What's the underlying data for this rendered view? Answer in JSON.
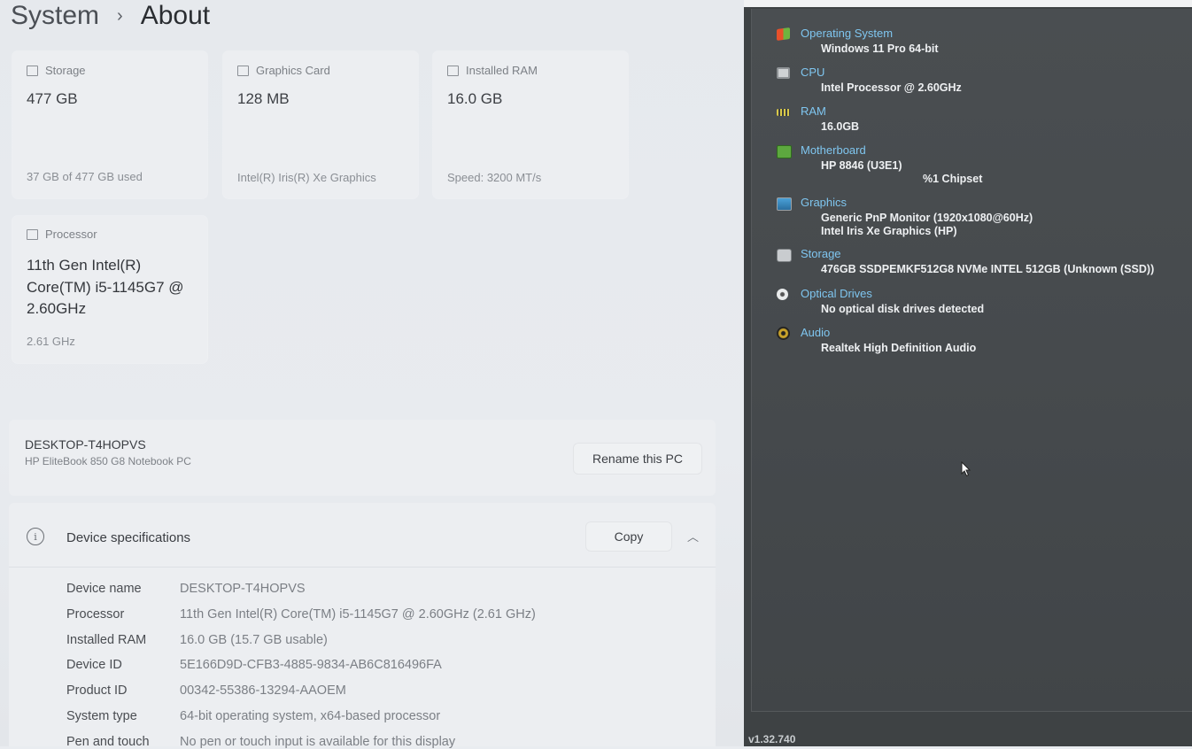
{
  "breadcrumb": {
    "parent": "System",
    "separator": "›",
    "current": "About"
  },
  "cards": {
    "storage": {
      "label": "Storage",
      "value": "477 GB",
      "sub": "37 GB of 477 GB used"
    },
    "graphics": {
      "label": "Graphics Card",
      "value": "128 MB",
      "sub": "Intel(R) Iris(R) Xe Graphics"
    },
    "ram": {
      "label": "Installed RAM",
      "value": "16.0 GB",
      "sub": "Speed: 3200 MT/s"
    },
    "processor": {
      "label": "Processor",
      "value": "11th Gen Intel(R) Core(TM) i5-1145G7 @ 2.60GHz",
      "sub": "2.61 GHz"
    }
  },
  "pc": {
    "name": "DESKTOP-T4HOPVS",
    "model": "HP EliteBook 850 G8 Notebook PC",
    "rename_label": "Rename this PC"
  },
  "specs": {
    "title": "Device specifications",
    "copy_label": "Copy",
    "rows": [
      {
        "key": "Device name",
        "value": "DESKTOP-T4HOPVS"
      },
      {
        "key": "Processor",
        "value": "11th Gen Intel(R) Core(TM) i5-1145G7 @ 2.60GHz (2.61 GHz)"
      },
      {
        "key": "Installed RAM",
        "value": "16.0 GB (15.7 GB usable)"
      },
      {
        "key": "Device ID",
        "value": "5E166D9D-CFB3-4885-9834-AB6C816496FA"
      },
      {
        "key": "Product ID",
        "value": "00342-55386-13294-AAOEM"
      },
      {
        "key": "System type",
        "value": "64-bit operating system, x64-based processor"
      },
      {
        "key": "Pen and touch",
        "value": "No pen or touch input is available for this display"
      }
    ]
  },
  "speccy": {
    "version": "v1.32.740",
    "items": [
      {
        "title": "Operating System",
        "icon": "windows-icon",
        "lines": [
          "Windows 11 Pro 64-bit"
        ]
      },
      {
        "title": "CPU",
        "icon": "cpu-icon",
        "lines": [
          "Intel Processor @ 2.60GHz"
        ]
      },
      {
        "title": "RAM",
        "icon": "ram-icon",
        "lines": [
          "16.0GB"
        ]
      },
      {
        "title": "Motherboard",
        "icon": "motherboard-icon",
        "lines": [
          "HP 8846 (U3E1)",
          "%1 Chipset"
        ]
      },
      {
        "title": "Graphics",
        "icon": "monitor-icon",
        "lines": [
          "Generic PnP Monitor (1920x1080@60Hz)",
          "Intel Iris Xe Graphics (HP)"
        ]
      },
      {
        "title": "Storage",
        "icon": "storage-icon",
        "lines": [
          "476GB SSDPEMKF512G8 NVMe INTEL 512GB (Unknown (SSD))"
        ]
      },
      {
        "title": "Optical Drives",
        "icon": "optical-drive-icon",
        "lines": [
          "No optical disk drives detected"
        ]
      },
      {
        "title": "Audio",
        "icon": "audio-icon",
        "lines": [
          "Realtek High Definition Audio"
        ]
      }
    ]
  },
  "colors": {
    "speccy_title": "#7fc6f0",
    "speccy_bg": "#464a4d",
    "settings_bg": "#e8ebef"
  }
}
